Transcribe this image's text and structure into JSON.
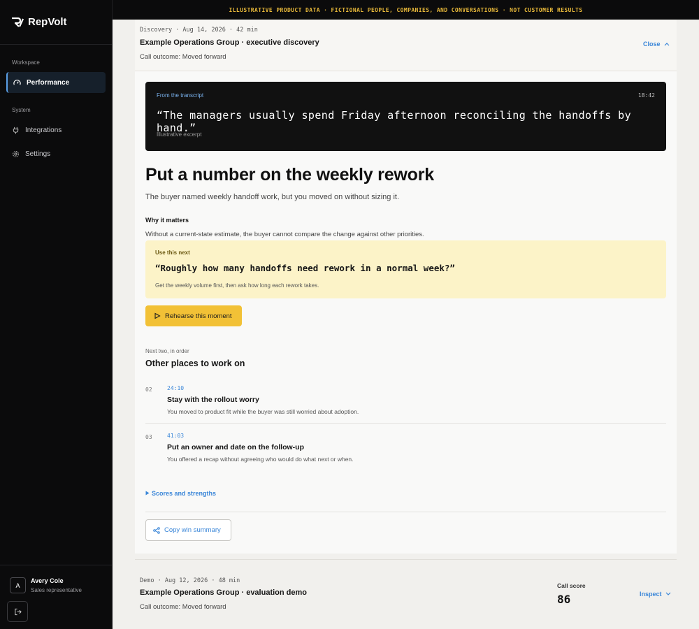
{
  "app": {
    "name": "RepVolt"
  },
  "banner": {
    "text": "ILLUSTRATIVE PRODUCT DATA · FICTIONAL PEOPLE, COMPANIES, AND CONVERSATIONS · NOT CUSTOMER RESULTS"
  },
  "sidebar": {
    "workspace_heading": "Workspace",
    "system_heading": "System",
    "items": [
      {
        "label": "Performance",
        "icon": "gauge-icon",
        "active": true
      },
      {
        "label": "Integrations",
        "icon": "plug-icon",
        "active": false
      },
      {
        "label": "Settings",
        "icon": "gear-icon",
        "active": false
      }
    ],
    "user": {
      "initial": "A",
      "name": "Avery Cole",
      "role": "Sales representative"
    }
  },
  "call1": {
    "meta": "Discovery · Aug 14, 2026 · 42 min",
    "title": "Example Operations Group · executive discovery",
    "outcome": "Call outcome: Moved forward",
    "close_label": "Close"
  },
  "transcript": {
    "label": "From the transcript",
    "time": "18:42",
    "quote": "“The managers usually spend Friday afternoon reconciling the handoffs by hand.”",
    "note": "Illustrative excerpt"
  },
  "coaching": {
    "headline": "Put a number on the weekly rework",
    "subline": "The buyer named weekly handoff work, but you moved on without sizing it.",
    "why_heading": "Why it matters",
    "why_text": "Without a current-state estimate, the buyer cannot compare the change against other priorities.",
    "use_next_label": "Use this next",
    "use_next_quote": "“Roughly how many handoffs need rework in a normal week?”",
    "use_next_note": "Get the weekly volume first, then ask how long each rework takes.",
    "rehearse_label": "Rehearse this moment"
  },
  "other": {
    "kicker": "Next two, in order",
    "heading": "Other places to work on",
    "items": [
      {
        "num": "02",
        "time": "24:10",
        "title": "Stay with the rollout worry",
        "desc": "You moved to product fit while the buyer was still worried about adoption."
      },
      {
        "num": "03",
        "time": "41:03",
        "title": "Put an owner and date on the follow-up",
        "desc": "You offered a recap without agreeing who would do what next or when."
      }
    ]
  },
  "scores_label": "Scores and strengths",
  "copy_label": "Copy win summary",
  "call2": {
    "meta": "Demo · Aug 12, 2026 · 48 min",
    "title": "Example Operations Group · evaluation demo",
    "outcome": "Call outcome: Moved forward",
    "score_label": "Call score",
    "score_value": "86",
    "inspect_label": "Inspect"
  },
  "colors": {
    "accent": "#3a86d8",
    "cta": "#f2c136",
    "highlight_bg": "#fcf3c8",
    "banner_text": "#e8b93a"
  }
}
